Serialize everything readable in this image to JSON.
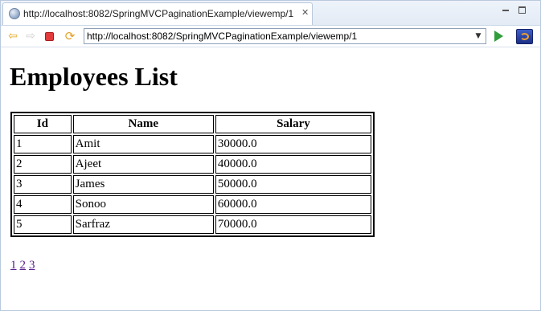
{
  "browser": {
    "tab_title": "http://localhost:8082/SpringMVCPaginationExample/viewemp/1",
    "address": "http://localhost:8082/SpringMVCPaginationExample/viewemp/1",
    "icons": [
      "globe-icon",
      "close-icon",
      "minimize-icon",
      "maximize-icon",
      "back-icon",
      "forward-icon",
      "stop-icon",
      "refresh-icon",
      "dropdown-icon",
      "go-icon",
      "eclipse-icon"
    ]
  },
  "page": {
    "heading": "Employees List",
    "table": {
      "headers": [
        "Id",
        "Name",
        "Salary"
      ],
      "rows": [
        [
          "1",
          "Amit",
          "30000.0"
        ],
        [
          "2",
          "Ajeet",
          "40000.0"
        ],
        [
          "3",
          "James",
          "50000.0"
        ],
        [
          "4",
          "Sonoo",
          "60000.0"
        ],
        [
          "5",
          "Sarfraz",
          "70000.0"
        ]
      ]
    },
    "pagination": [
      "1",
      "2",
      "3"
    ]
  },
  "colors": {
    "link_visited": "#551a8b",
    "stop_red": "#e33b3b",
    "go_green": "#2f9e3b"
  }
}
